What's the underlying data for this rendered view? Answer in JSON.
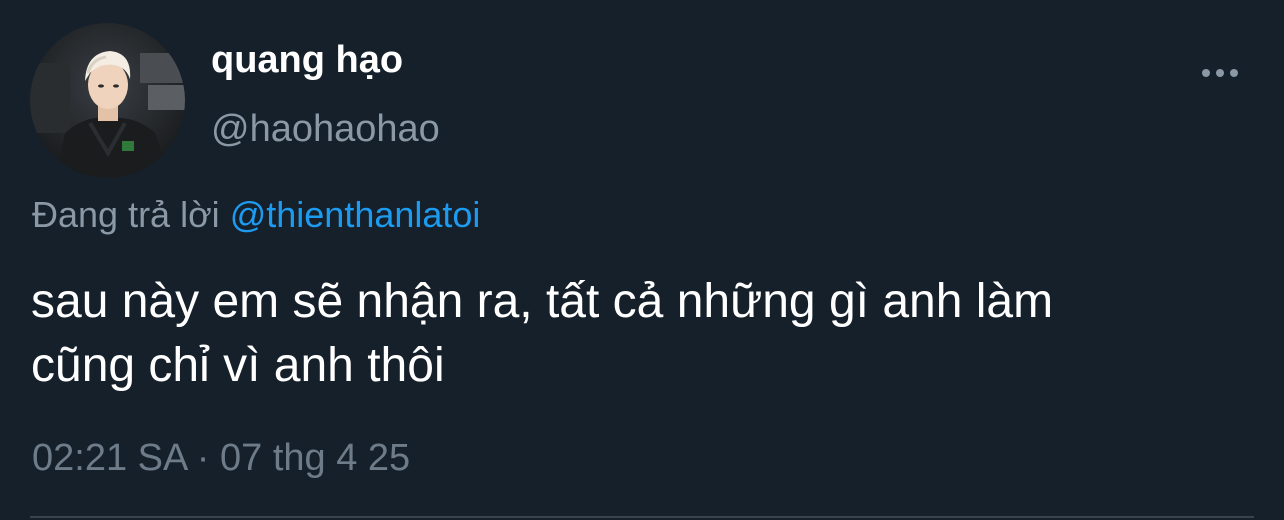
{
  "author": {
    "display_name": "quang hạo",
    "handle": "@haohaohao"
  },
  "more_icon": "more-horizontal-icon",
  "reply": {
    "prefix": "Đang trả lời",
    "mention": "@thienthanlatoi"
  },
  "tweet": {
    "line1": "sau này em sẽ nhận ra, tất cả những gì anh làm",
    "line2": "cũng chỉ vì anh thôi"
  },
  "meta": {
    "timestamp": "02:21 SA · 07 thg 4 25"
  },
  "colors": {
    "background": "#15202b",
    "primary_text": "#ffffff",
    "secondary_text": "#8b98a5",
    "link": "#1d9bf0",
    "divider": "#38444d"
  }
}
